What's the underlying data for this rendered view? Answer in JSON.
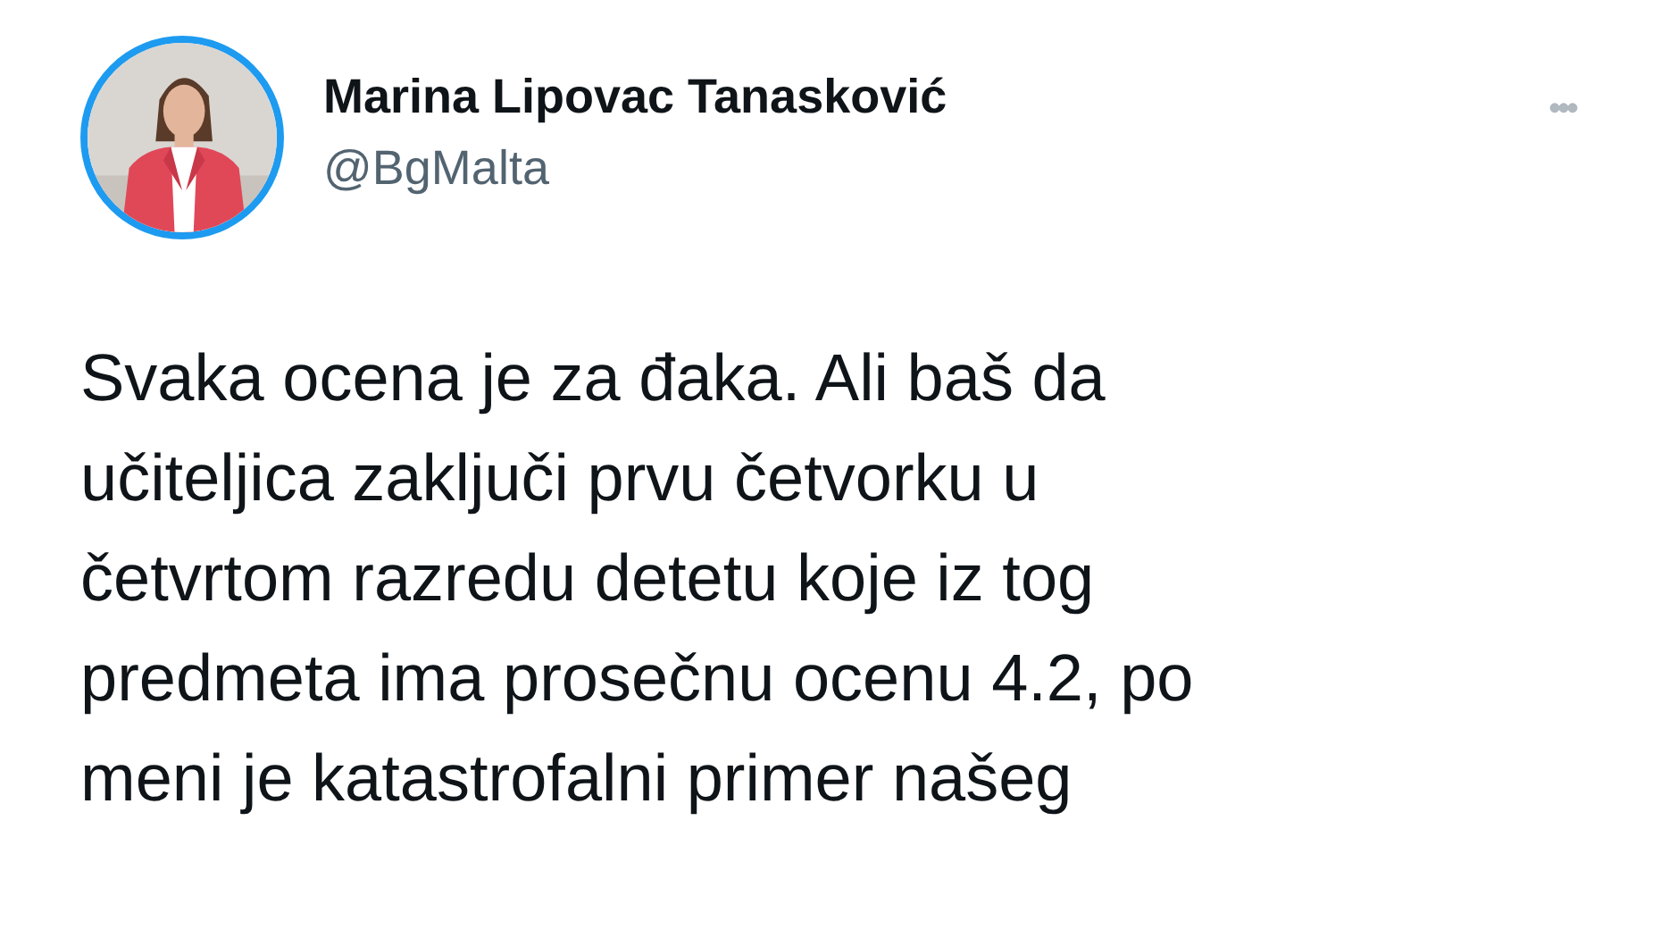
{
  "author": {
    "name": "Marina Lipovac Tanasković",
    "handle": "@BgMalta"
  },
  "more_menu": {
    "label": "•••"
  },
  "tweet_lines": [
    "Svaka ocena je za đaka. Ali baš da",
    "učiteljica zaključi prvu četvorku u",
    "četvrtom razredu detetu koje iz tog",
    "predmeta ima prosečnu ocenu 4.2, po",
    "meni je katastrofalni primer našeg"
  ]
}
